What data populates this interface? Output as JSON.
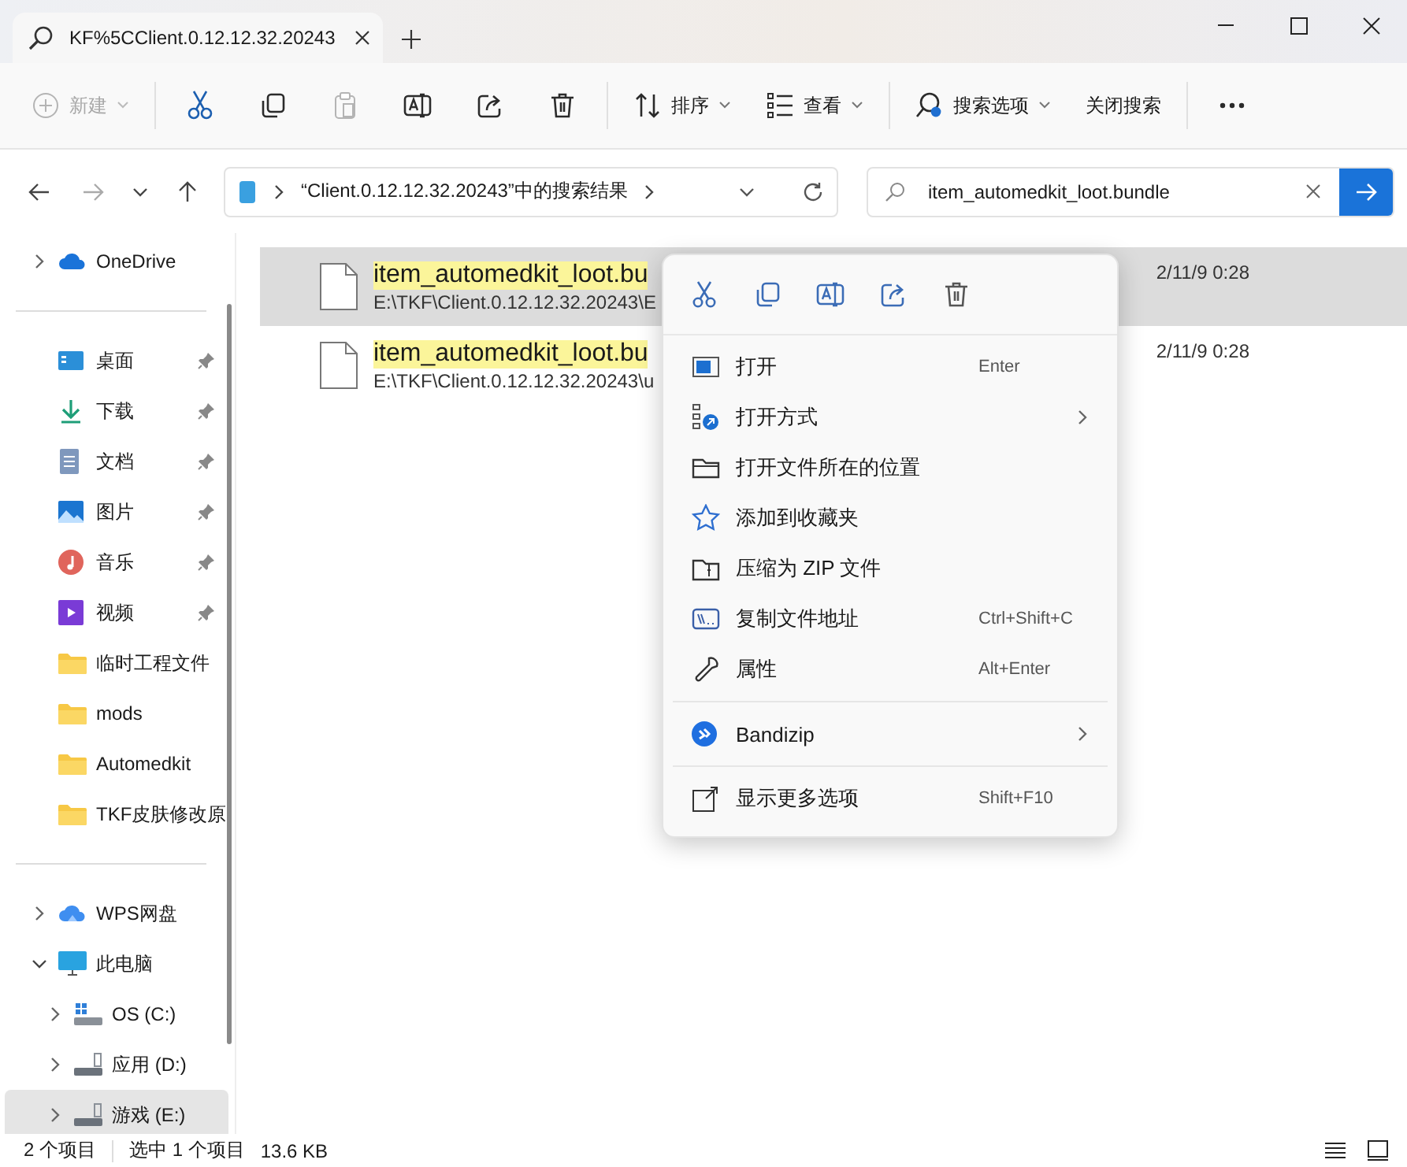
{
  "window": {
    "tab_title": "KF%5CClient.0.12.12.32.20243"
  },
  "toolbar": {
    "groups": [
      [
        {
          "kind": "new",
          "label": "新建",
          "disabled": true,
          "dropdown": true
        }
      ],
      [
        {
          "kind": "cut",
          "disabled": false,
          "dropdown": false
        },
        {
          "kind": "copy",
          "disabled": false,
          "dropdown": false
        },
        {
          "kind": "paste",
          "disabled": true,
          "dropdown": false
        },
        {
          "kind": "rename",
          "disabled": false,
          "dropdown": false
        },
        {
          "kind": "share",
          "disabled": false,
          "dropdown": false
        },
        {
          "kind": "delete",
          "disabled": false,
          "dropdown": false
        }
      ],
      [
        {
          "kind": "sort",
          "label": "排序",
          "disabled": false,
          "dropdown": true
        },
        {
          "kind": "view",
          "label": "查看",
          "disabled": false,
          "dropdown": true
        }
      ],
      [
        {
          "kind": "search-options",
          "label": "搜索选项",
          "disabled": false,
          "dropdown": true
        },
        {
          "kind": "text",
          "label": "关闭搜索",
          "disabled": false,
          "dropdown": false
        }
      ],
      [
        {
          "kind": "more",
          "disabled": false,
          "dropdown": false
        }
      ]
    ]
  },
  "address": {
    "breadcrumb": "“Client.0.12.12.32.20243”中的搜索结果"
  },
  "search": {
    "value": "item_automedkit_loot.bundle"
  },
  "sidebar": {
    "sections": [
      [
        {
          "kind": "cloud",
          "label": "OneDrive",
          "expanded": false,
          "pinned": false,
          "selected": false
        }
      ],
      [
        {
          "kind": "desktop",
          "label": "桌面",
          "pinned": true,
          "selected": false
        },
        {
          "kind": "download",
          "label": "下载",
          "pinned": true,
          "selected": false
        },
        {
          "kind": "documents",
          "label": "文档",
          "pinned": true,
          "selected": false
        },
        {
          "kind": "pictures",
          "label": "图片",
          "pinned": true,
          "selected": false
        },
        {
          "kind": "music",
          "label": "音乐",
          "pinned": true,
          "selected": false
        },
        {
          "kind": "videos",
          "label": "视频",
          "pinned": true,
          "selected": false
        },
        {
          "kind": "folder",
          "label": "临时工程文件",
          "pinned": false,
          "selected": false
        },
        {
          "kind": "folder",
          "label": "mods",
          "pinned": false,
          "selected": false
        },
        {
          "kind": "folder",
          "label": "Automedkit",
          "pinned": false,
          "selected": false
        },
        {
          "kind": "folder",
          "label": "TKF皮肤修改原",
          "pinned": false,
          "selected": false
        }
      ],
      [
        {
          "kind": "wps",
          "label": "WPS网盘",
          "expanded": false,
          "pinned": false,
          "selected": false
        },
        {
          "kind": "pc",
          "label": "此电脑",
          "expanded": true,
          "pinned": false,
          "selected": false,
          "children": [
            {
              "kind": "os-drive",
              "label": "OS (C:)",
              "expanded": false,
              "pinned": false,
              "selected": false
            },
            {
              "kind": "drive",
              "label": "应用 (D:)",
              "expanded": false,
              "pinned": false,
              "selected": false
            },
            {
              "kind": "drive",
              "label": "游戏 (E:)",
              "expanded": false,
              "pinned": false,
              "selected": true
            }
          ]
        }
      ]
    ]
  },
  "files": [
    {
      "name": "item_automedkit_loot.bu",
      "path": "E:\\TKF\\Client.0.12.12.32.20243\\E",
      "date": "2/11/9 0:28",
      "selected": true
    },
    {
      "name": "item_automedkit_loot.bu",
      "path": "E:\\TKF\\Client.0.12.12.32.20243\\u",
      "date": "2/11/9 0:28",
      "selected": false
    }
  ],
  "context_menu": {
    "groups": [
      [
        {
          "kind": "open",
          "label": "打开",
          "shortcut": "Enter",
          "submenu": false
        },
        {
          "kind": "open-with",
          "label": "打开方式",
          "submenu": true
        },
        {
          "kind": "folder",
          "label": "打开文件所在的位置",
          "submenu": false
        },
        {
          "kind": "favorite",
          "label": "添加到收藏夹",
          "submenu": false
        },
        {
          "kind": "zip",
          "label": "压缩为 ZIP 文件",
          "submenu": false
        },
        {
          "kind": "copy-path",
          "label": "复制文件地址",
          "shortcut": "Ctrl+Shift+C",
          "submenu": false
        },
        {
          "kind": "properties",
          "label": "属性",
          "shortcut": "Alt+Enter",
          "submenu": false
        }
      ],
      [
        {
          "kind": "bandizip",
          "label": "Bandizip",
          "submenu": true
        }
      ],
      [
        {
          "kind": "more",
          "label": "显示更多选项",
          "shortcut": "Shift+F10",
          "submenu": false
        }
      ]
    ]
  },
  "status_bar": {
    "item_count": "2 个项目",
    "selection": "选中 1 个项目",
    "size": "13.6 KB"
  }
}
